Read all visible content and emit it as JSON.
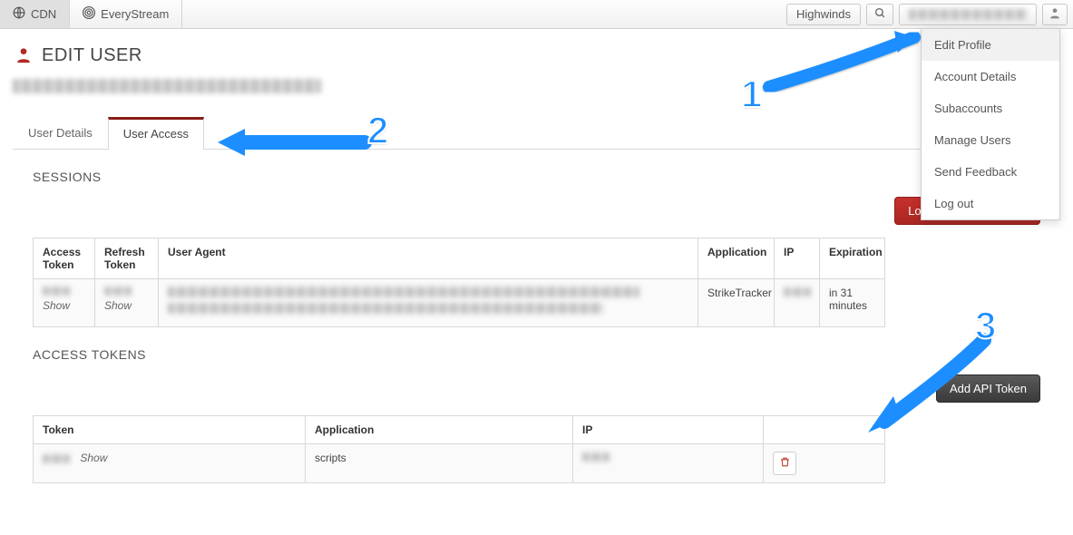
{
  "topnav": {
    "cdn_label": "CDN",
    "everystream_label": "EveryStream",
    "search_btn_label": "Highwinds"
  },
  "dropdown": {
    "items": [
      {
        "label": "Edit Profile"
      },
      {
        "label": "Account Details"
      },
      {
        "label": "Subaccounts"
      },
      {
        "label": "Manage Users"
      },
      {
        "label": "Send Feedback"
      },
      {
        "label": "Log out"
      }
    ]
  },
  "page": {
    "title": "EDIT USER",
    "tabs": [
      {
        "label": "User Details",
        "active": false
      },
      {
        "label": "User Access",
        "active": true
      }
    ]
  },
  "sessions": {
    "heading": "SESSIONS",
    "logout_other_btn": "Log out other sessions",
    "columns": {
      "access": "Access Token",
      "refresh": "Refresh Token",
      "user_agent": "User Agent",
      "application": "Application",
      "ip": "IP",
      "expiration": "Expiration"
    },
    "row": {
      "show_label": "Show",
      "application": "StrikeTracker",
      "expiration": "in 31 minutes"
    }
  },
  "tokens": {
    "heading": "ACCESS TOKENS",
    "add_btn": "Add API Token",
    "columns": {
      "token": "Token",
      "application": "Application",
      "ip": "IP"
    },
    "row": {
      "show_label": "Show",
      "application": "scripts"
    }
  },
  "annotations": {
    "n1": "1",
    "n2": "2",
    "n3": "3"
  }
}
